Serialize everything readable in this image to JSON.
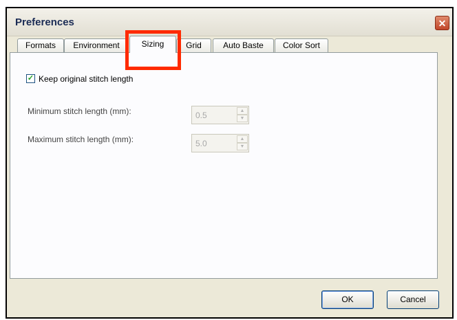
{
  "window": {
    "title": "Preferences",
    "close_glyph": "✕"
  },
  "tabs": [
    {
      "label": "Formats",
      "active": false
    },
    {
      "label": "Environment",
      "active": false
    },
    {
      "label": "Sizing",
      "active": true
    },
    {
      "label": "Grid",
      "active": false
    },
    {
      "label": "Auto Baste",
      "active": false
    },
    {
      "label": "Color Sort",
      "active": false
    }
  ],
  "sizing": {
    "keep_original": {
      "label": "Keep original stitch length",
      "checked": true,
      "check_glyph": "✓"
    },
    "minimum": {
      "label": "Minimum stitch length (mm):",
      "value": "0.5"
    },
    "maximum": {
      "label": "Maximum stitch length (mm):",
      "value": "5.0"
    },
    "spin_up_glyph": "▲",
    "spin_down_glyph": "▼"
  },
  "buttons": {
    "ok": "OK",
    "cancel": "Cancel"
  },
  "colors": {
    "highlight": "#ff2a00",
    "dialog_background": "#ece9d8",
    "title_text": "#1b2c55"
  },
  "icons": {
    "close": "close-icon",
    "check": "checkmark-icon"
  }
}
